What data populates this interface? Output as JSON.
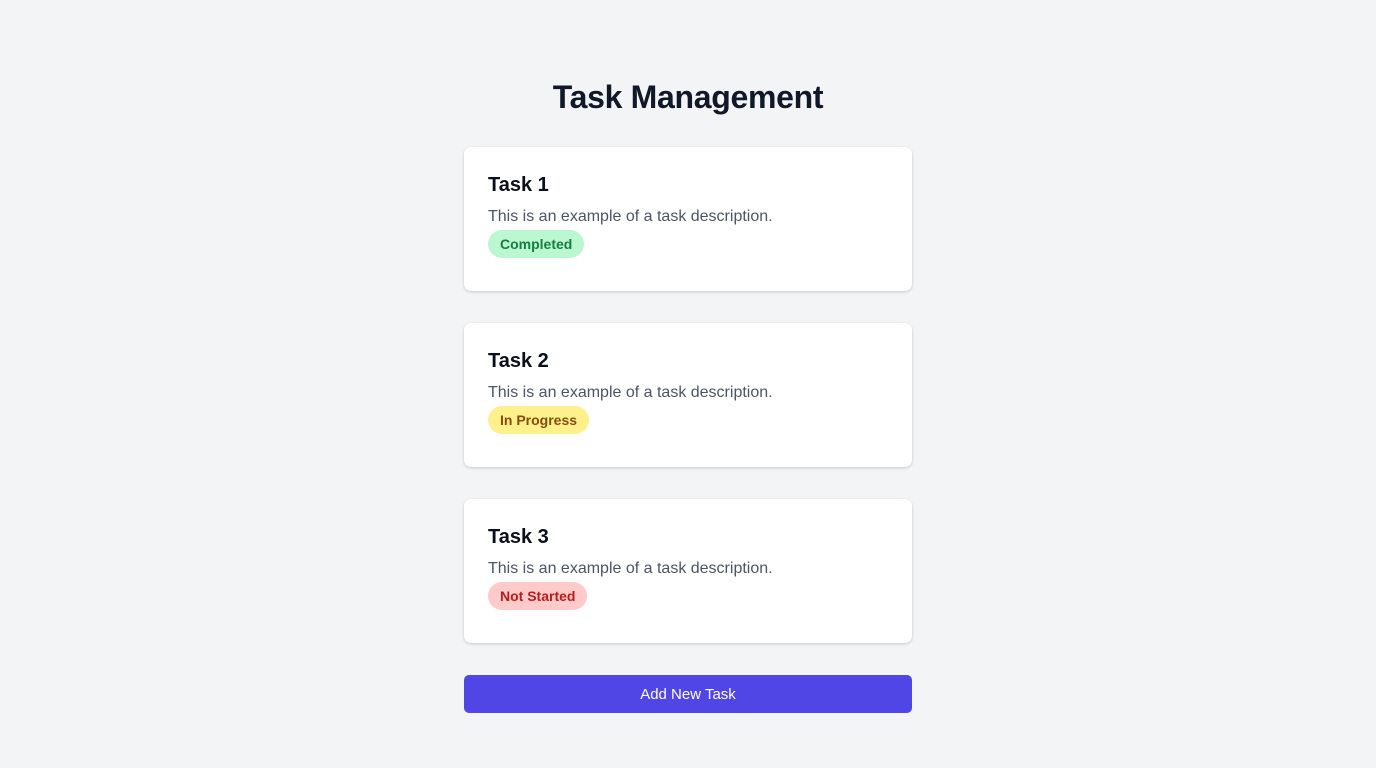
{
  "header": {
    "title": "Task Management"
  },
  "tasks": [
    {
      "title": "Task 1",
      "description": "This is an example of a task description.",
      "status": "Completed"
    },
    {
      "title": "Task 2",
      "description": "This is an example of a task description.",
      "status": "In Progress"
    },
    {
      "title": "Task 3",
      "description": "This is an example of a task description.",
      "status": "Not Started"
    }
  ],
  "actions": {
    "add_task_label": "Add New Task"
  },
  "colors": {
    "background": "#f3f4f6",
    "primary": "#4f46e5",
    "completed_bg": "#bbf7d0",
    "completed_text": "#15803d",
    "in_progress_bg": "#fef08a",
    "in_progress_text": "#854d0e",
    "not_started_bg": "#fecaca",
    "not_started_text": "#b91c1c"
  }
}
